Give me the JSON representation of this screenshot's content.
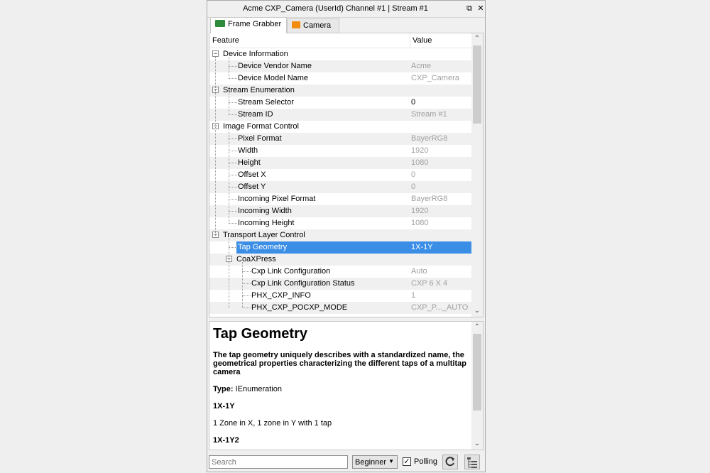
{
  "window": {
    "title": "Acme CXP_Camera (UserId) Channel #1 | Stream #1",
    "restore_glyph": "⧉",
    "close_glyph": "✕"
  },
  "tabs": [
    {
      "label": "Frame Grabber",
      "icon": "frame-grabber-icon",
      "color": "#2e8b3a",
      "active": true
    },
    {
      "label": "Camera",
      "icon": "camera-icon",
      "color": "#f28c0f",
      "active": false
    }
  ],
  "grid": {
    "header": {
      "feature": "Feature",
      "value": "Value"
    },
    "rows": [
      {
        "label": "Device Information",
        "value": "",
        "level": 0,
        "group": true
      },
      {
        "label": "Device Vendor Name",
        "value": "Acme",
        "level": 1
      },
      {
        "label": "Device Model Name",
        "value": "CXP_Camera",
        "level": 1
      },
      {
        "label": "Stream Enumeration",
        "value": "",
        "level": 0,
        "group": true
      },
      {
        "label": "Stream Selector",
        "value": "0",
        "level": 1,
        "editable": true
      },
      {
        "label": "Stream ID",
        "value": "Stream #1",
        "level": 1
      },
      {
        "label": "Image Format Control",
        "value": "",
        "level": 0,
        "group": true
      },
      {
        "label": "Pixel Format",
        "value": "BayerRG8",
        "level": 1
      },
      {
        "label": "Width",
        "value": "1920",
        "level": 1
      },
      {
        "label": "Height",
        "value": "1080",
        "level": 1
      },
      {
        "label": "Offset X",
        "value": "0",
        "level": 1
      },
      {
        "label": "Offset Y",
        "value": "0",
        "level": 1
      },
      {
        "label": "Incoming Pixel Format",
        "value": "BayerRG8",
        "level": 1
      },
      {
        "label": "Incoming Width",
        "value": "1920",
        "level": 1
      },
      {
        "label": "Incoming Height",
        "value": "1080",
        "level": 1
      },
      {
        "label": "Transport Layer Control",
        "value": "",
        "level": 0,
        "group": true
      },
      {
        "label": "Tap Geometry",
        "value": "1X-1Y",
        "level": 1,
        "selected": true
      },
      {
        "label": "CoaXPress",
        "value": "",
        "level": 1,
        "group": true
      },
      {
        "label": "Cxp Link Configuration",
        "value": "Auto",
        "level": 2
      },
      {
        "label": "Cxp Link Configuration Status",
        "value": "CXP 6 X 4",
        "level": 2
      },
      {
        "label": "PHX_CXP_INFO",
        "value": "1",
        "level": 2
      },
      {
        "label": "PHX_CXP_POCXP_MODE",
        "value": "CXP_P..._AUTO",
        "level": 2
      }
    ]
  },
  "description": {
    "title": "Tap Geometry",
    "summary": "The tap geometry uniquely describes with a standardized name, the geometrical properties characterizing the different taps of a multitap camera",
    "type_label": "Type:",
    "type_value": "IEnumeration",
    "entries": [
      {
        "name": "1X-1Y",
        "text": "1 Zone in X, 1 zone in Y with 1 tap"
      },
      {
        "name": "1X-1Y2",
        "text": ""
      }
    ]
  },
  "bottom": {
    "search_placeholder": "Search",
    "visibility": "Beginner",
    "polling_label": "Polling",
    "polling_checked": true,
    "refresh_icon": "refresh-icon",
    "tree_icon": "tree-view-icon"
  }
}
